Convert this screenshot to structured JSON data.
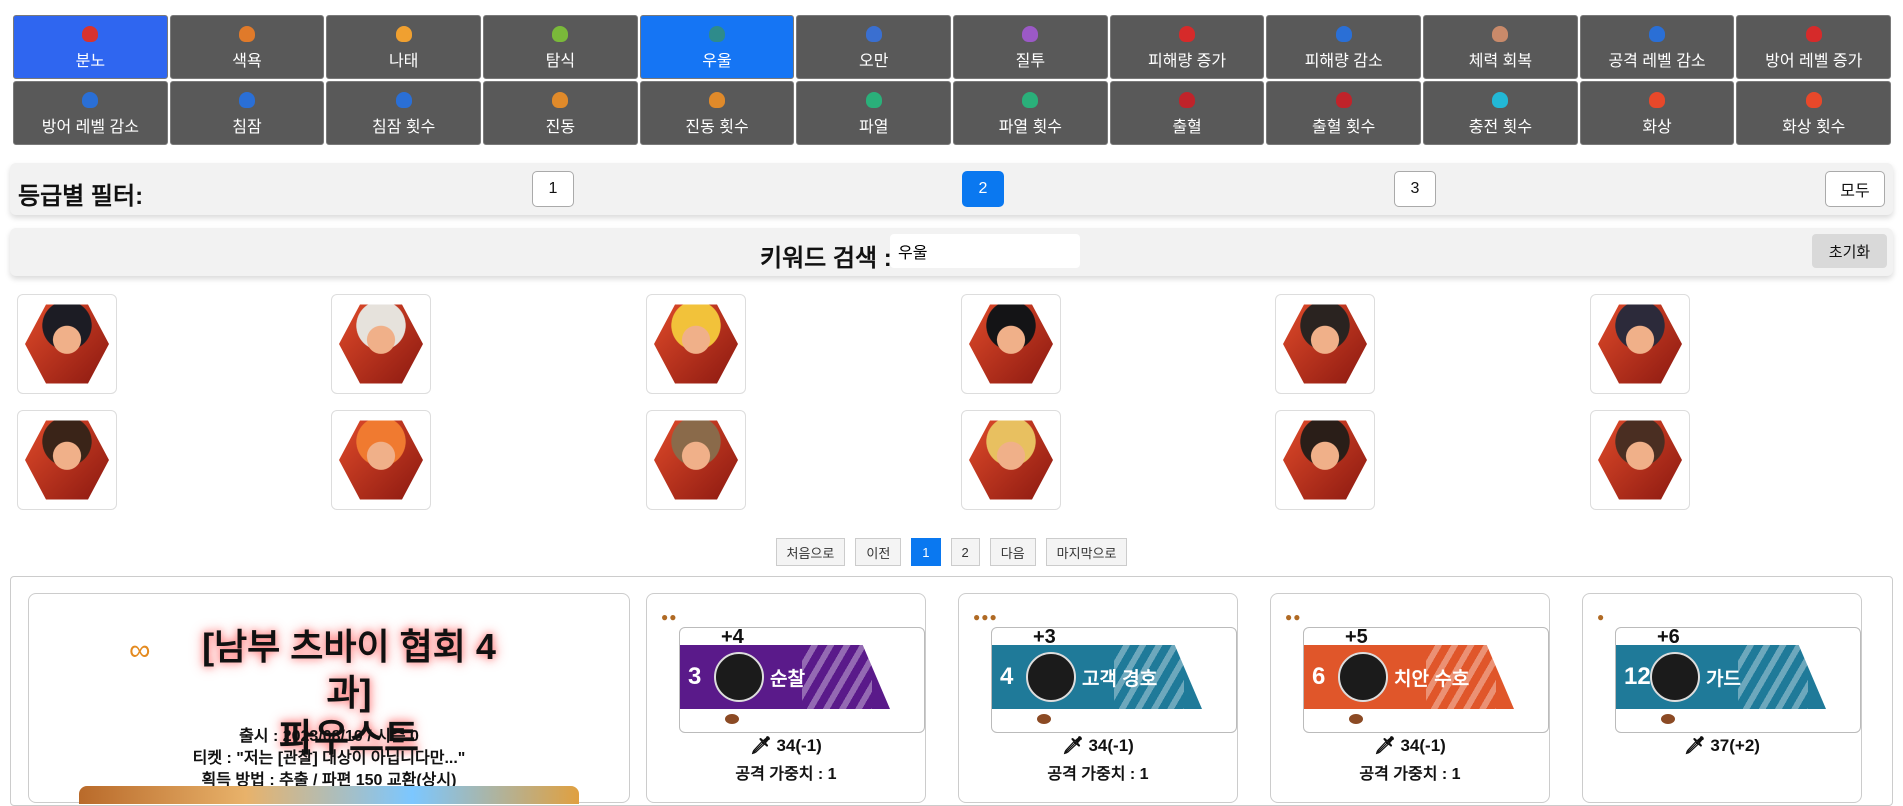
{
  "keyword_tabs_row1": [
    {
      "label": "분노",
      "icon": "wrath-icon",
      "color": "#d7332e"
    },
    {
      "label": "색욕",
      "icon": "lust-icon",
      "color": "#e07a2a"
    },
    {
      "label": "나태",
      "icon": "sloth-icon",
      "color": "#f0a030"
    },
    {
      "label": "탐식",
      "icon": "gluttony-icon",
      "color": "#7ab93a"
    },
    {
      "label": "우울",
      "icon": "gloom-icon",
      "color": "#2e8b8b"
    },
    {
      "label": "오만",
      "icon": "pride-icon",
      "color": "#3a6fd0"
    },
    {
      "label": "질투",
      "icon": "envy-icon",
      "color": "#9b59c6"
    },
    {
      "label": "피해량 증가",
      "icon": "damage-up-icon",
      "color": "#d62a2a"
    },
    {
      "label": "피해량 감소",
      "icon": "damage-down-icon",
      "color": "#2a6fd6"
    },
    {
      "label": "체력 회복",
      "icon": "heal-icon",
      "color": "#c98a6a"
    },
    {
      "label": "공격 레벨 감소",
      "icon": "attack-level-down-icon",
      "color": "#2a6fd6"
    },
    {
      "label": "방어 레벨 증가",
      "icon": "defense-level-up-icon",
      "color": "#d62a2a"
    }
  ],
  "keyword_tabs_row2": [
    {
      "label": "방어 레벨 감소",
      "icon": "defense-level-down-icon",
      "color": "#2a6fd6"
    },
    {
      "label": "침잠",
      "icon": "sinking-icon",
      "color": "#2a6fd6"
    },
    {
      "label": "침잠 횟수",
      "icon": "sinking-count-icon",
      "color": "#2a6fd6"
    },
    {
      "label": "진동",
      "icon": "tremor-icon",
      "color": "#e08a2a"
    },
    {
      "label": "진동 횟수",
      "icon": "tremor-count-icon",
      "color": "#e08a2a"
    },
    {
      "label": "파열",
      "icon": "rupture-icon",
      "color": "#2ab07a"
    },
    {
      "label": "파열 횟수",
      "icon": "rupture-count-icon",
      "color": "#2ab07a"
    },
    {
      "label": "출혈",
      "icon": "bleed-icon",
      "color": "#c0232a"
    },
    {
      "label": "출혈 횟수",
      "icon": "bleed-count-icon",
      "color": "#c0232a"
    },
    {
      "label": "충전 횟수",
      "icon": "charge-count-icon",
      "color": "#22b8d6"
    },
    {
      "label": "화상",
      "icon": "burn-icon",
      "color": "#e8482a"
    },
    {
      "label": "화상 횟수",
      "icon": "burn-count-icon",
      "color": "#e8482a"
    }
  ],
  "active_tab_index_row1": 0,
  "selected_tab_index_row1": 4,
  "grade_filter": {
    "title": "등급별 필터:",
    "options": [
      "1",
      "2",
      "3",
      "모두"
    ],
    "selected": "2"
  },
  "keyword_search": {
    "label": "키워드 검색 :",
    "value": "우울",
    "reset_label": "초기화"
  },
  "portraits": [
    {
      "name": "portrait-1",
      "hair": "#1c1c24"
    },
    {
      "name": "portrait-2",
      "hair": "#e6e2dc"
    },
    {
      "name": "portrait-3",
      "hair": "#f2c23a"
    },
    {
      "name": "portrait-4",
      "hair": "#141416"
    },
    {
      "name": "portrait-5",
      "hair": "#2a2320"
    },
    {
      "name": "portrait-6",
      "hair": "#2c2a3a"
    },
    {
      "name": "portrait-7",
      "hair": "#3a2418"
    },
    {
      "name": "portrait-8",
      "hair": "#f07a30"
    },
    {
      "name": "portrait-9",
      "hair": "#8a6a4a"
    },
    {
      "name": "portrait-10",
      "hair": "#e8c060"
    },
    {
      "name": "portrait-11",
      "hair": "#2a1e18"
    },
    {
      "name": "portrait-12",
      "hair": "#4a2e22"
    }
  ],
  "pagination": {
    "first": "처음으로",
    "prev": "이전",
    "pages": [
      "1",
      "2"
    ],
    "current": "1",
    "next": "다음",
    "last": "마지막으로"
  },
  "identity": {
    "title_line1": "[남부 츠바이 협회 4과]",
    "title_line2": "파우스트",
    "release": "출시 : 2023/08/10 / 시즌 0",
    "ticket": "티켓 : \"저는 [관찰] 대상이 아닙니다만...\"",
    "acquire": "획득 방법 : 추출 / 파편 150 교환(상시)"
  },
  "skills": [
    {
      "coins": "●●",
      "power": "+4",
      "base": "3",
      "name": "순찰",
      "color": "#5a1a8a",
      "attack": "34(-1)",
      "weight": "공격 가중치 : 1"
    },
    {
      "coins": "●●●",
      "power": "+3",
      "base": "4",
      "name": "고객 경호",
      "color": "#1f7a99",
      "attack": "34(-1)",
      "weight": "공격 가중치 : 1"
    },
    {
      "coins": "●●",
      "power": "+5",
      "base": "6",
      "name": "치안 수호",
      "color": "#e0562a",
      "attack": "34(-1)",
      "weight": "공격 가중치 : 1"
    },
    {
      "coins": "●",
      "power": "+6",
      "base": "12",
      "name": "가드",
      "color": "#1f7a99",
      "attack": "37(+2)",
      "weight": ""
    }
  ]
}
